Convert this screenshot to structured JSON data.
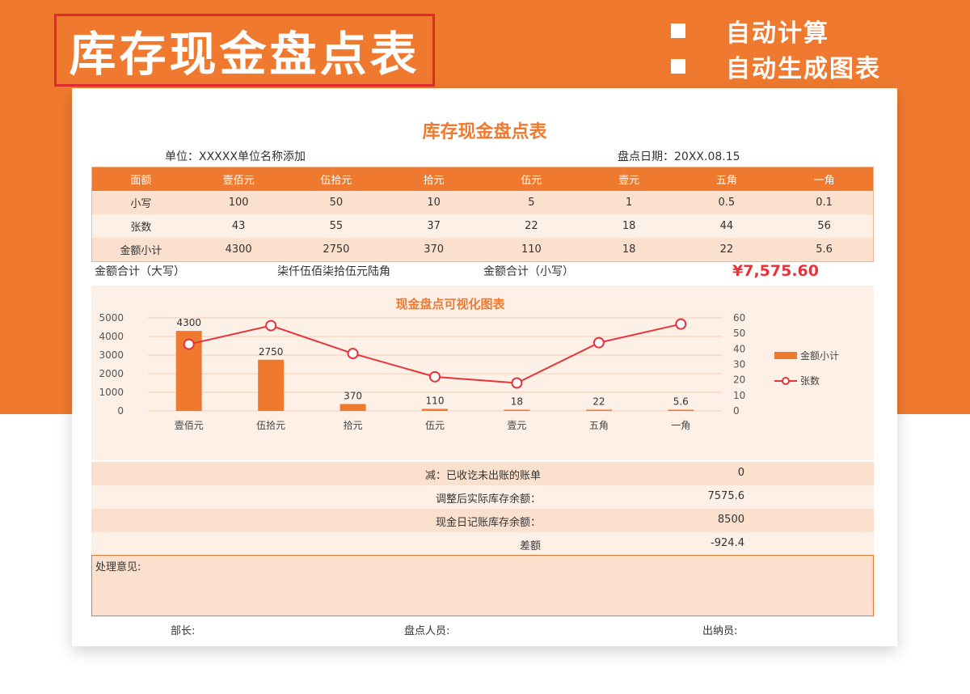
{
  "banner": {
    "title": "库存现金盘点表",
    "features": [
      "自动计算",
      "自动生成图表"
    ]
  },
  "sheet": {
    "title": "库存现金盘点表",
    "unit": "单位：XXXXX单位名称添加",
    "date": "盘点日期：20XX.08.15",
    "table": {
      "headers": [
        "面额",
        "壹佰元",
        "伍拾元",
        "拾元",
        "伍元",
        "壹元",
        "五角",
        "一角"
      ],
      "rows": [
        [
          "小写",
          "100",
          "50",
          "10",
          "5",
          "1",
          "0.5",
          "0.1"
        ],
        [
          "张数",
          "43",
          "55",
          "37",
          "22",
          "18",
          "44",
          "56"
        ],
        [
          "金额小计",
          "4300",
          "2750",
          "370",
          "110",
          "18",
          "22",
          "5.6"
        ]
      ]
    },
    "summary": {
      "total_upper_label": "金额合计（大写）",
      "total_upper_value": "柒仟伍佰柒拾伍元陆角",
      "total_lower_label": "金额合计（小写）",
      "total_lower_value": "¥7,575.60"
    },
    "calc_rows": [
      {
        "label": "减：已收讫未出账的账单",
        "value": "0"
      },
      {
        "label": "调整后实际库存余额：",
        "value": "7575.6"
      },
      {
        "label": "现金日记账库存余额：",
        "value": "8500"
      },
      {
        "label": "差额",
        "value": "-924.4"
      }
    ],
    "opinion_label": "处理意见:",
    "signatures": {
      "head": "部长:",
      "counter": "盘点人员:",
      "cashier": "出纳员:"
    }
  },
  "chart_data": {
    "type": "bar",
    "title": "现金盘点可视化图表",
    "categories": [
      "壹佰元",
      "伍拾元",
      "拾元",
      "伍元",
      "壹元",
      "五角",
      "一角"
    ],
    "series": [
      {
        "name": "金额小计",
        "type": "bar",
        "axis": "left",
        "values": [
          4300,
          2750,
          370,
          110,
          18,
          22,
          5.6
        ],
        "color": "#ef7a2f"
      },
      {
        "name": "张数",
        "type": "line",
        "axis": "right",
        "values": [
          43,
          55,
          37,
          22,
          18,
          44,
          56
        ],
        "color": "#e8333a"
      }
    ],
    "data_labels": [
      "4300",
      "2750",
      "370",
      "110",
      "18",
      "22",
      "5.6"
    ],
    "ylim_left": [
      0,
      5000
    ],
    "yticks_left": [
      "0",
      "1000",
      "2000",
      "3000",
      "4000",
      "5000"
    ],
    "ylim_right": [
      0,
      60
    ],
    "yticks_right": [
      "0",
      "10",
      "20",
      "30",
      "40",
      "50",
      "60"
    ],
    "grid": true,
    "legend": "right"
  },
  "colors": {
    "brand": "#ef7a2f",
    "accent": "#e8333a"
  }
}
